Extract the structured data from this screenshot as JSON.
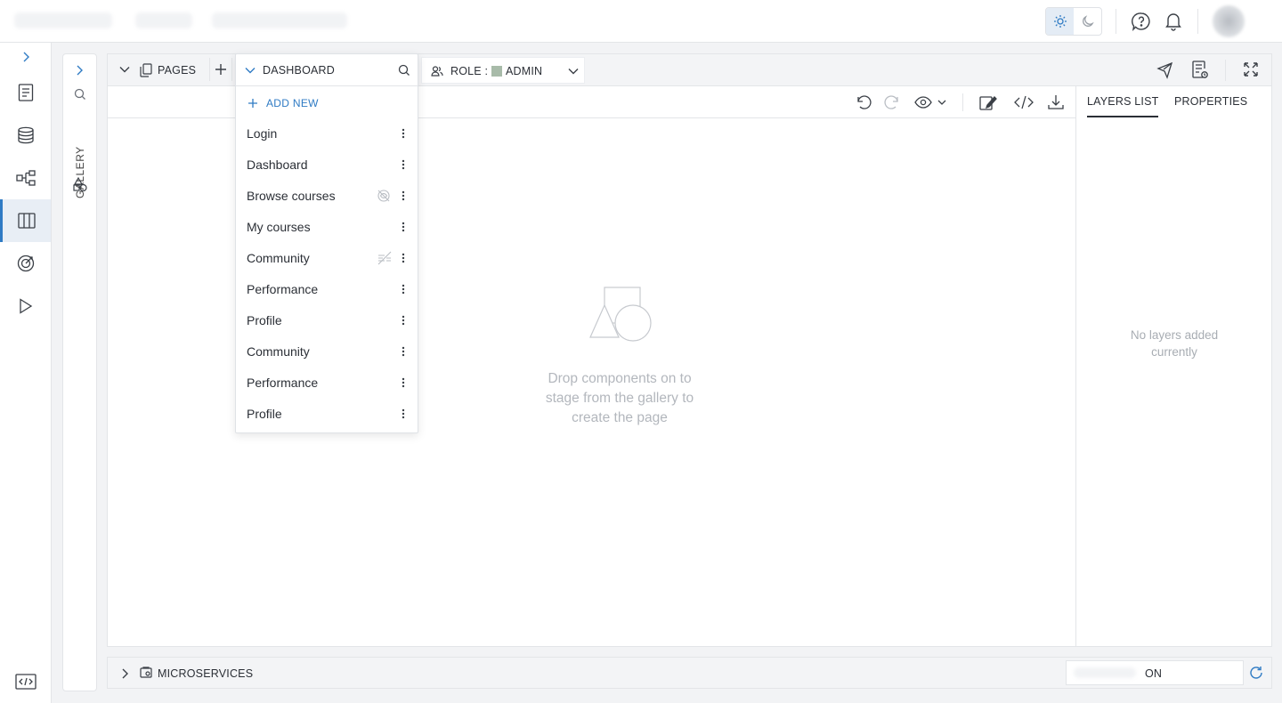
{
  "header": {
    "theme_light_icon": "sun-icon",
    "theme_dark_icon": "moon-icon",
    "help_icon": "help-icon",
    "notification_icon": "bell-icon"
  },
  "rail": {
    "items": [
      "document-icon",
      "database-icon",
      "workflow-icon",
      "pages-icon",
      "target-icon",
      "play-icon"
    ],
    "active": "pages-icon",
    "bottom_icon": "code-icon"
  },
  "gallery": {
    "label": "GALLERY"
  },
  "editor": {
    "pages_label": "PAGES",
    "role_label": "ROLE :",
    "role_value": "ADMIN",
    "role_color": "#a8bba9"
  },
  "dropdown": {
    "selected": "DASHBOARD",
    "add_new": "ADD NEW",
    "items": [
      {
        "label": "Login"
      },
      {
        "label": "Dashboard"
      },
      {
        "label": "Browse courses",
        "status": "eye-off-icon"
      },
      {
        "label": "My courses"
      },
      {
        "label": "Community",
        "status": "hidden-nav-icon"
      },
      {
        "label": "Performance"
      },
      {
        "label": "Profile"
      },
      {
        "label": "Community"
      },
      {
        "label": "Performance"
      },
      {
        "label": "Profile"
      }
    ]
  },
  "stage": {
    "empty_text": "Drop components on to stage from the gallery to create the page"
  },
  "right_panel": {
    "tabs": [
      "LAYERS LIST",
      "PROPERTIES"
    ],
    "active_tab": "LAYERS LIST",
    "empty_text": "No layers added currently"
  },
  "bottom": {
    "microservices_label": "MICROSERVICES",
    "status_value": "ON"
  },
  "colors": {
    "accent": "#2f7bc4",
    "muted_text": "#b3b7bd"
  }
}
